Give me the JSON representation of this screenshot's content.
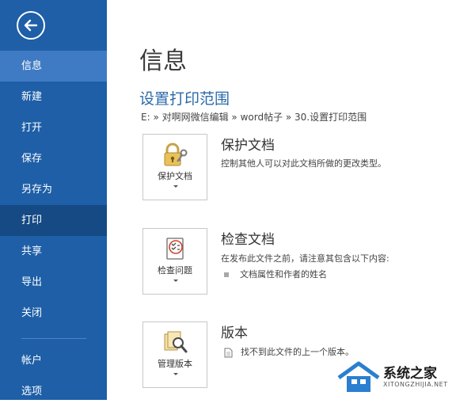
{
  "sidebar": {
    "items": [
      {
        "label": "信息"
      },
      {
        "label": "新建"
      },
      {
        "label": "打开"
      },
      {
        "label": "保存"
      },
      {
        "label": "另存为"
      },
      {
        "label": "打印"
      },
      {
        "label": "共享"
      },
      {
        "label": "导出"
      },
      {
        "label": "关闭"
      },
      {
        "label": "帐户"
      },
      {
        "label": "选项"
      }
    ]
  },
  "main": {
    "page_title": "信息",
    "doc_title": "设置打印范围",
    "path": "E: » 对啊网微信编辑 » word帖子 » 30.设置打印范围",
    "sections": [
      {
        "tile_label": "保护文档",
        "title": "保护文档",
        "description": "控制其他人可以对此文档所做的更改类型。"
      },
      {
        "tile_label": "检查问题",
        "title": "检查文档",
        "description": "在发布此文件之前，请注意其包含以下内容:",
        "bullet": "文档属性和作者的姓名"
      },
      {
        "tile_label": "管理版本",
        "title": "版本",
        "bullet": "找不到此文件的上一个版本。"
      }
    ]
  },
  "watermark": {
    "text_cn": "系统之家",
    "text_en": "XITONGZHIJIA.NET"
  },
  "colors": {
    "sidebar": "#1e5fa7",
    "sidebar_selected": "#3f7bc4",
    "sidebar_hover": "#154a84",
    "accent_title": "#2b6aa8"
  }
}
